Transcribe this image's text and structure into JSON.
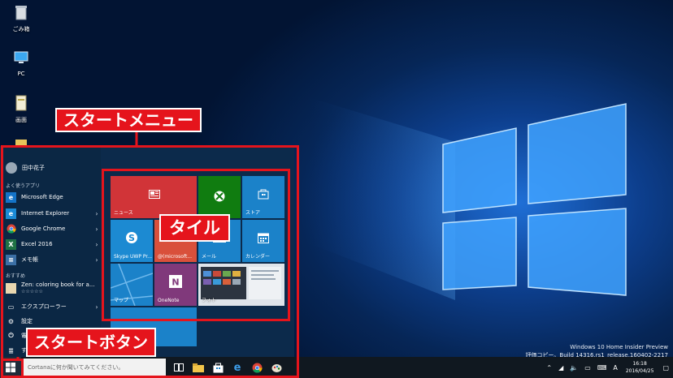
{
  "desktop_icons": [
    {
      "label": "ごみ箱",
      "icon": "recycle-bin-icon"
    },
    {
      "label": "PC",
      "icon": "pc-icon"
    },
    {
      "label": "画面",
      "icon": "document-icon"
    }
  ],
  "start_menu": {
    "user": "田中花子",
    "most_used_header": "よく使うアプリ",
    "most_used": [
      {
        "label": "Microsoft Edge",
        "icon": "edge-icon",
        "color": "#1473c7",
        "arrow": false
      },
      {
        "label": "Internet Explorer",
        "icon": "ie-icon",
        "color": "#1b8bd6",
        "arrow": true
      },
      {
        "label": "Google Chrome",
        "icon": "chrome-icon",
        "color": "#ffffff",
        "arrow": true
      },
      {
        "label": "Excel 2016",
        "icon": "excel-icon",
        "color": "#1f7244",
        "arrow": true
      },
      {
        "label": "メモ帳",
        "icon": "notepad-icon",
        "color": "#3b6fa5",
        "arrow": true
      }
    ],
    "recommended_header": "おすすめ",
    "recommended": {
      "label": "Zen: coloring book for a...",
      "stars": "☆☆☆☆☆"
    },
    "explorer": "エクスプローラー",
    "settings": "設定",
    "power": "電源",
    "all_apps": "すべ"
  },
  "tiles": [
    {
      "key": "news",
      "label": "ニュース",
      "icon": "news-icon",
      "color": "#d13438"
    },
    {
      "key": "xbox",
      "label": "",
      "icon": "xbox-icon",
      "color": "#107c10"
    },
    {
      "key": "store",
      "label": "ストア",
      "icon": "store-icon",
      "color": "#1b82c9"
    },
    {
      "key": "skype",
      "label": "Skype UWP Pr...",
      "icon": "skype-icon",
      "color": "#1c8ad2"
    },
    {
      "key": "mail-account",
      "label": "@(microsoft...",
      "icon": "mail-icon",
      "color": "#d9503b"
    },
    {
      "key": "mail",
      "label": "メール",
      "icon": "mail-icon",
      "color": "#1b82c9"
    },
    {
      "key": "calendar",
      "label": "カレンダー",
      "icon": "calendar-icon",
      "color": "#1b82c9"
    },
    {
      "key": "maps",
      "label": "マップ",
      "icon": "map-icon",
      "color": "#1b82c9"
    },
    {
      "key": "onenote",
      "label": "OneNote",
      "icon": "onenote-icon",
      "color": "#80397b"
    },
    {
      "key": "photos",
      "label": "フォト",
      "icon": "photos-icon",
      "color": "#cfd6de"
    },
    {
      "key": "extra",
      "label": "",
      "icon": "tile-icon",
      "color": "#1b82c9"
    }
  ],
  "annotations": {
    "start_menu": "スタートメニュー",
    "tiles": "タイル",
    "start_button": "スタートボタン"
  },
  "taskbar": {
    "search_placeholder": "Cortanaに何か聞いてみてください。",
    "apps": [
      "task-view-icon",
      "file-explorer-icon",
      "store-icon",
      "edge-icon",
      "chrome-icon",
      "paint-icon"
    ],
    "time": "16:18",
    "date": "2016/04/25"
  },
  "watermark": {
    "line1": "Windows 10 Home Insider Preview",
    "line2": "評価コピー。Build 14316.rs1_release.160402-2217"
  },
  "colors": {
    "annotation_red": "#e5141c",
    "accent": "#1b82c9",
    "start_bg": "#0c2a4b"
  }
}
